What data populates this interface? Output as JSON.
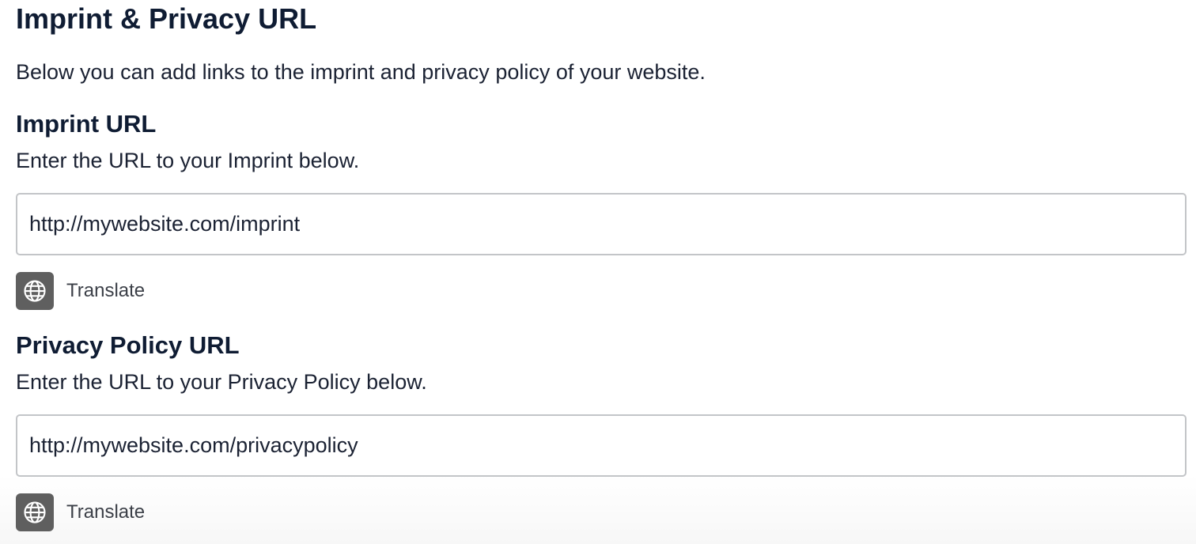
{
  "page": {
    "title": "Imprint & Privacy URL",
    "description": "Below you can add links to the imprint and privacy policy of your website."
  },
  "imprint": {
    "title": "Imprint URL",
    "help": "Enter the URL to your Imprint below.",
    "value": "http://mywebsite.com/imprint",
    "translate_label": "Translate",
    "translate_icon": "globe-icon"
  },
  "privacy": {
    "title": "Privacy Policy URL",
    "help": "Enter the URL to your Privacy Policy below.",
    "value": "http://mywebsite.com/privacypolicy",
    "translate_label": "Translate",
    "translate_icon": "globe-icon"
  },
  "colors": {
    "heading": "#0f1c33",
    "input_border": "#c3c5c8",
    "icon_button_bg": "#5f5f5f"
  }
}
